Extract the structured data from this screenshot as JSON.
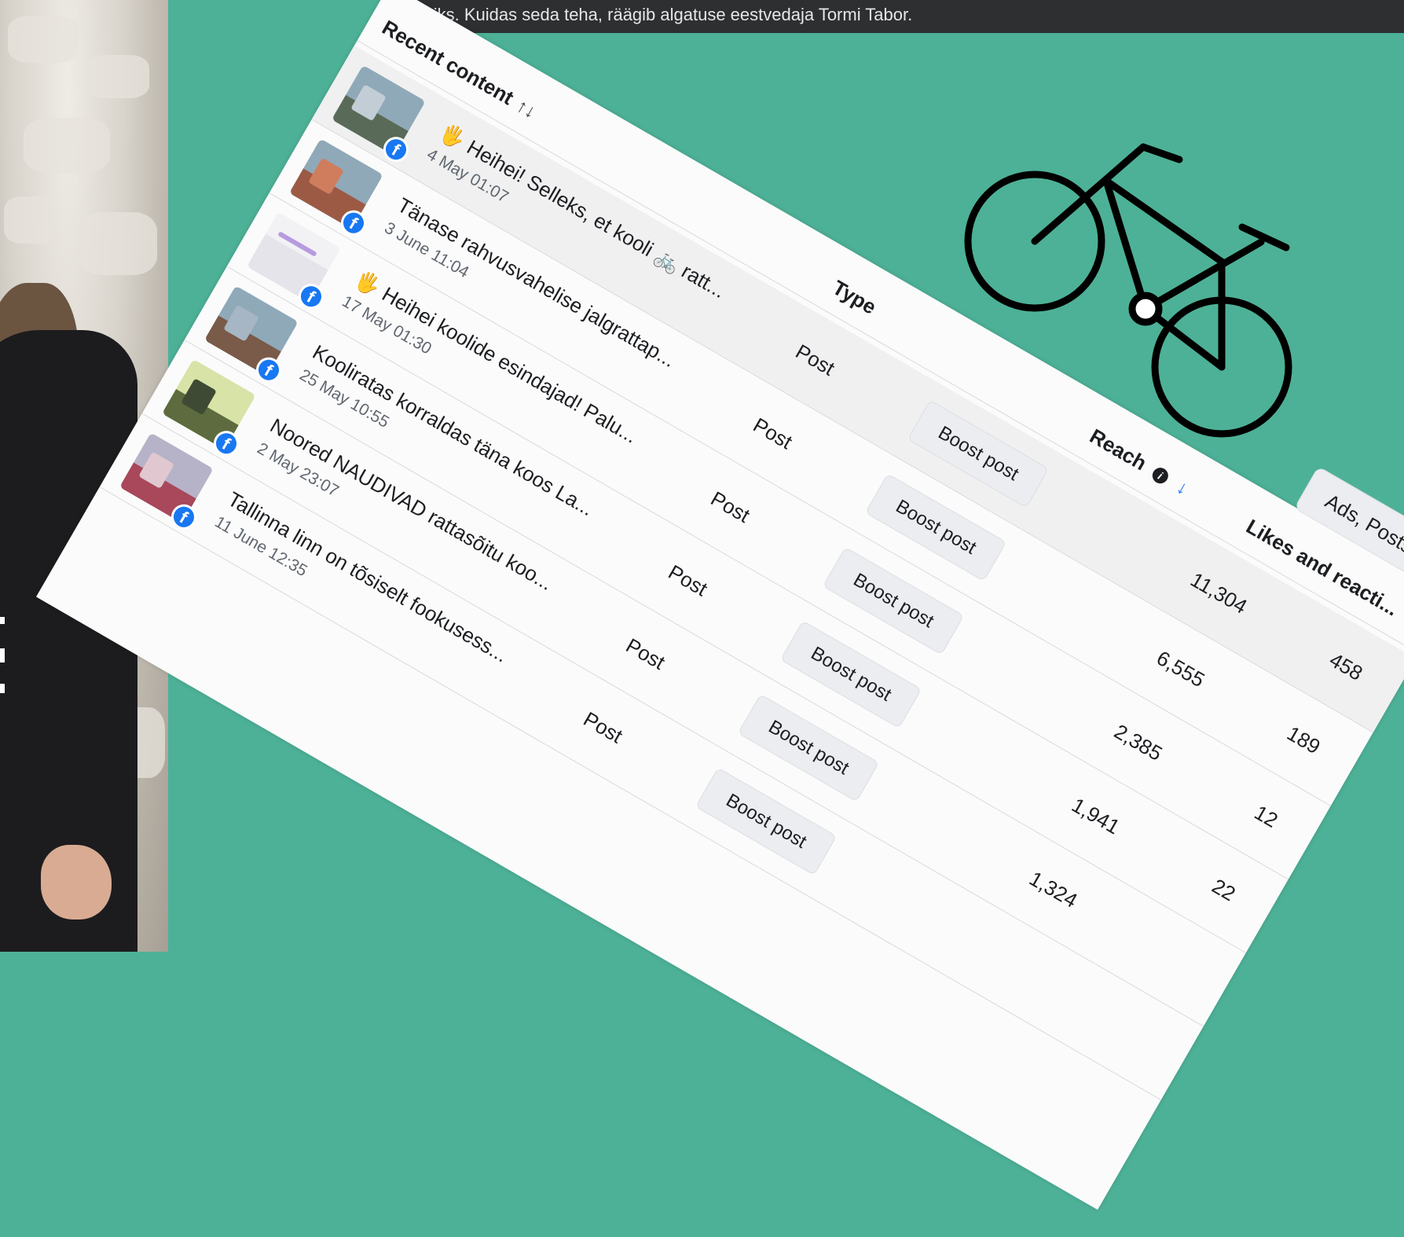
{
  "caption": "viisiks. Kuidas seda teha, räägib algatuse eestvedaja Tormi Tabor.",
  "table": {
    "col_content": "Recent content",
    "col_type": "Type",
    "col_reach": "Reach",
    "col_likes": "Likes and reacti...",
    "filter_label": "Ads, Posts and Stor",
    "sort_icon": "↑↓",
    "sort_desc_icon": "↓",
    "info_icon": "i",
    "fb_icon": "f",
    "rows": [
      {
        "title": "🖐 Heihei! Selleks, et kooli 🚲 ratt...",
        "date": "4 May 01:07",
        "type": "Post",
        "boost": "Boost post",
        "reach": "11,304",
        "likes": "458"
      },
      {
        "title": "Tänase rahvusvahelise jalgrattap...",
        "date": "3 June 11:04",
        "type": "Post",
        "boost": "Boost post",
        "reach": "6,555",
        "likes": "189"
      },
      {
        "title": "🖐 Heihei koolide esindajad! Palu...",
        "date": "17 May 01:30",
        "type": "Post",
        "boost": "Boost post",
        "reach": "2,385",
        "likes": "12"
      },
      {
        "title": "Kooliratas korraldas täna koos La...",
        "date": "25 May 10:55",
        "type": "Post",
        "boost": "Boost post",
        "reach": "1,941",
        "likes": "22"
      },
      {
        "title": "Noored NAUDIVAD rattasõitu koo...",
        "date": "2 May 23:07",
        "type": "Post",
        "boost": "Boost post",
        "reach": "1,324",
        "likes": ""
      },
      {
        "title": "Tallinna linn on tõsiselt fookusess...",
        "date": "11 June 12:35",
        "type": "Post",
        "boost": "Boost post",
        "reach": "",
        "likes": ""
      }
    ]
  }
}
